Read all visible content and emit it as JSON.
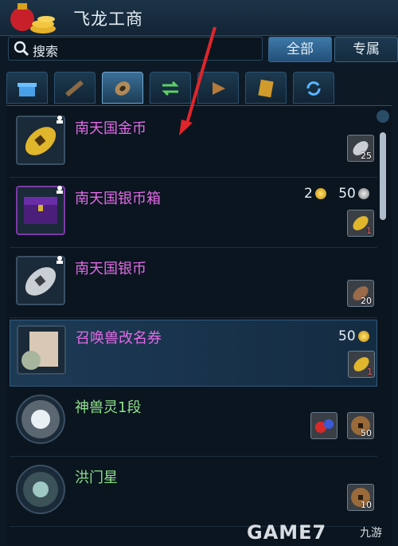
{
  "app": {
    "title": "飞龙工商"
  },
  "search": {
    "label": "搜索"
  },
  "scope": {
    "all": "全部",
    "own": "专属"
  },
  "tabs": [
    {
      "icon": "gift-box-icon"
    },
    {
      "icon": "weapon-icon"
    },
    {
      "icon": "coin-icon"
    },
    {
      "icon": "exchange-arrows-icon"
    },
    {
      "icon": "play-arrow-icon"
    },
    {
      "icon": "book-icon"
    },
    {
      "icon": "refresh-icon"
    }
  ],
  "items": [
    {
      "name": "南天国金币",
      "price": "",
      "cost": [
        {
          "icon": "silver-coin-icon",
          "count": "25"
        }
      ]
    },
    {
      "name": "南天国银币箱",
      "price_gold": "2",
      "price_silver": "50",
      "cost": [
        {
          "icon": "gold-coin-icon",
          "count": "1"
        }
      ]
    },
    {
      "name": "南天国银币",
      "cost": [
        {
          "icon": "copper-coin-icon",
          "count": "20"
        }
      ]
    },
    {
      "name": "召唤兽改名券",
      "price_gold": "50",
      "cost": [
        {
          "icon": "gold-coin-icon",
          "count": "1"
        }
      ]
    },
    {
      "name": "神兽灵1段",
      "cost": [
        {
          "icon": "gem-icon",
          "count": ""
        },
        {
          "icon": "copper-coin-icon",
          "count": "50"
        }
      ]
    },
    {
      "name": "洪门星",
      "cost": [
        {
          "icon": "copper-coin-icon",
          "count": "10"
        }
      ]
    }
  ],
  "watermark": {
    "main": "GAME7",
    "tail": "九游"
  },
  "colors": {
    "item_name": "#e36ae6",
    "accent": "#3d79a8",
    "arrow": "#e0252b"
  }
}
